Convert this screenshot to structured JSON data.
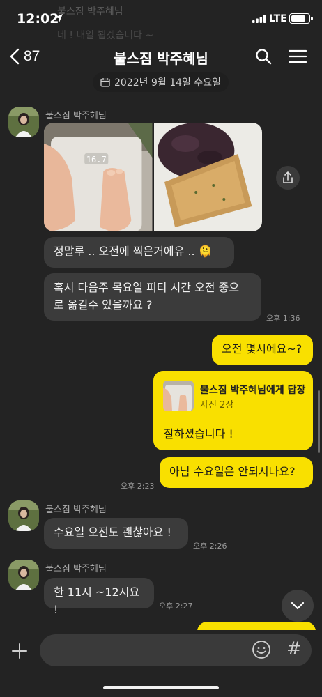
{
  "status_bar": {
    "time": "12:02",
    "network": "LTE",
    "battery_level": 0.85,
    "faded_header_text": "불스짐 박주혜님",
    "faded_message_text": "네 ! 내일 뵙겠습니다 ~"
  },
  "nav": {
    "back_count": "87",
    "title": "불스짐 박주혜님"
  },
  "date_divider": "2022년 9월 14일 수요일",
  "messages": {
    "m1": {
      "sender": "불스짐 박주혜님",
      "text": "정말루 .. 오전에 찍은거에유 .. 🫠"
    },
    "m2": {
      "text": "혹시 다음주 목요일 피티 시간 오전 중으\n로 옮길수 있을까요 ?",
      "time": "오후 1:36"
    },
    "m3": {
      "text": "오전 몇시에요~?"
    },
    "m4": {
      "reply_to": "불스짐 박주혜님에게 답장",
      "reply_sub": "사진 2장",
      "text": "잘하셨습니다 !"
    },
    "m5": {
      "text": "아님 수요일은 안되시나요?",
      "time": "오후 2:23"
    },
    "m6": {
      "sender": "불스짐 박주혜님",
      "text": "수요일 오전도 괜찮아요 !",
      "time": "오후 2:26"
    },
    "m7": {
      "sender": "불스짐 박주혜님",
      "text": "한 11시 ~12시요 !",
      "time": "오후 2:27"
    }
  },
  "scale_readout": "16.7",
  "input": {
    "placeholder": "",
    "value": ""
  },
  "colors": {
    "background": "#232323",
    "incoming": "#3b3b3b",
    "outgoing": "#f9e000"
  },
  "icons": [
    "back-chevron-icon",
    "search-icon",
    "menu-icon",
    "calendar-icon",
    "share-icon",
    "chevron-down-icon",
    "plus-icon",
    "emoji-icon",
    "hash-icon"
  ]
}
